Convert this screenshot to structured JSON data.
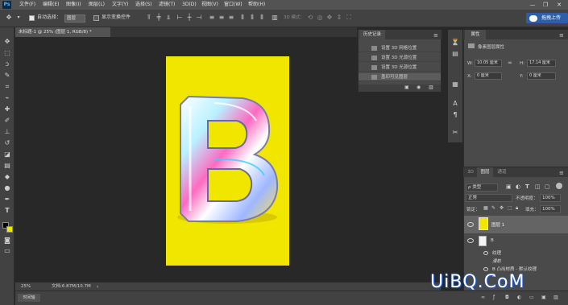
{
  "app": {
    "logo": "Ps"
  },
  "menu": [
    "文件(F)",
    "编辑(E)",
    "图像(I)",
    "图层(L)",
    "文字(Y)",
    "选择(S)",
    "滤镜(T)",
    "3D(D)",
    "视图(V)",
    "窗口(W)",
    "帮助(H)"
  ],
  "window_controls": {
    "minimize": "—",
    "restore": "❐",
    "close": "✕"
  },
  "options_bar": {
    "auto_select_label": "自动选择：",
    "layer_select_value": "图层",
    "show_transform_label": "显示变换控件",
    "mode_3d_label": "3D 模式："
  },
  "upload_button": {
    "label": "拖拽上传"
  },
  "document": {
    "tab_title": "未标题-1 @ 25% (图层 1, RGB/8) *",
    "zoom": "25%",
    "doc_info": "文档:6.87M/10.7M"
  },
  "timeline": {
    "tab_label": "时间轴"
  },
  "history_panel": {
    "tab": "历史记录",
    "items": [
      "设置 3D 网格位置",
      "设置 3D 光源位置",
      "设置 3D 光源位置",
      "盖印可见图层"
    ]
  },
  "properties_panel": {
    "tab": "属性",
    "subtitle": "像素图层属性",
    "w_label": "W:",
    "w_value": "10.05 厘米",
    "h_label": "H:",
    "h_value": "17.14 厘米",
    "x_label": "X:",
    "x_value": "0 厘米",
    "y_label": "Y:",
    "y_value": "0 厘米"
  },
  "layers_panel": {
    "tabs": [
      "3D",
      "图层",
      "通道"
    ],
    "filter_kind": "ρ 类型",
    "blend_mode": "正常",
    "opacity_label": "不透明度：",
    "opacity_value": "100%",
    "lock_label": "锁定：",
    "fill_label": "填充：",
    "fill_value": "100%",
    "layers": [
      {
        "name": "图层 1",
        "selected": true
      },
      {
        "name": "B",
        "selected": false
      }
    ],
    "sub_items": [
      "纹理",
      "漫射",
      "B 凸出材质 - 默认纹理",
      "B"
    ]
  },
  "letter": {
    "text": "B"
  },
  "watermark": {
    "text": "UiBQ.CoM"
  },
  "colors": {
    "artboard": "#f1e600",
    "menu_bg": "#535353",
    "panel_bg": "#4a4a4a",
    "canvas_bg": "#282828",
    "upload_button": "#2f5ea8"
  }
}
